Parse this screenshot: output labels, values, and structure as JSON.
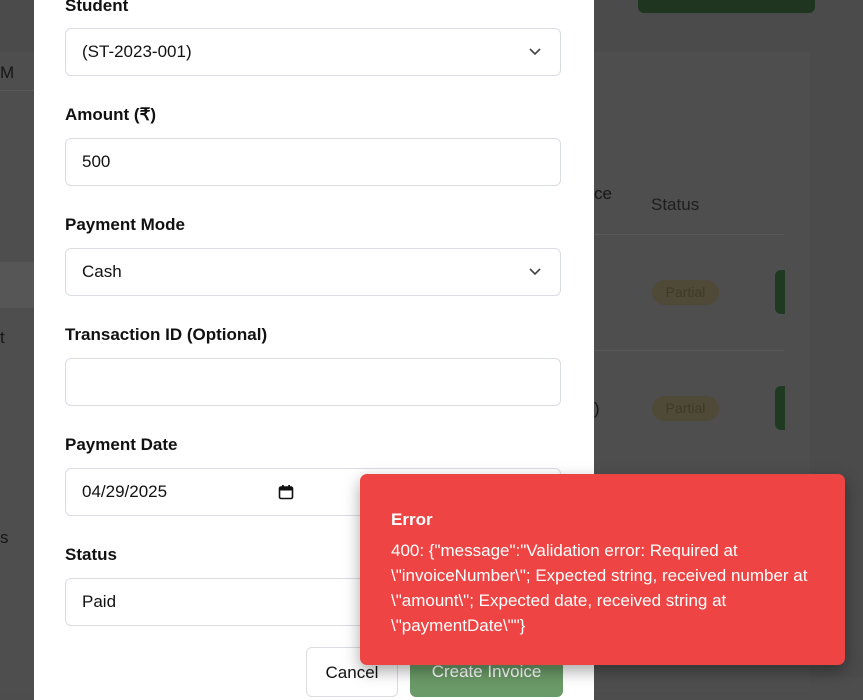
{
  "background": {
    "col_fragment": "M",
    "table_header_fragment": "ce",
    "status_header": "Status",
    "row1_fragment": "t",
    "row2_fragment": ")",
    "row3_fragment": "s",
    "badges": [
      "Partial",
      "Partial"
    ]
  },
  "form": {
    "student_label": "Student",
    "student_value": "(ST-2023-001)",
    "amount_label": "Amount (₹)",
    "amount_value": "500",
    "payment_mode_label": "Payment Mode",
    "payment_mode_value": "Cash",
    "transaction_label": "Transaction ID (Optional)",
    "transaction_value": "",
    "payment_date_label": "Payment Date",
    "payment_date_value": "04/29/2025",
    "status_label": "Status",
    "status_value": "Paid",
    "cancel_label": "Cancel",
    "create_label": "Create Invoice"
  },
  "toast": {
    "title": "Error",
    "message": "400: {\"message\":\"Validation error: Required at \\\"invoiceNumber\\\"; Expected string, received number at \\\"amount\\\"; Expected date, received string at \\\"paymentDate\\\"\"}"
  },
  "colors": {
    "error": "#ef4444",
    "primary": "#6a9a67",
    "overlay": "#4b4b4b"
  }
}
